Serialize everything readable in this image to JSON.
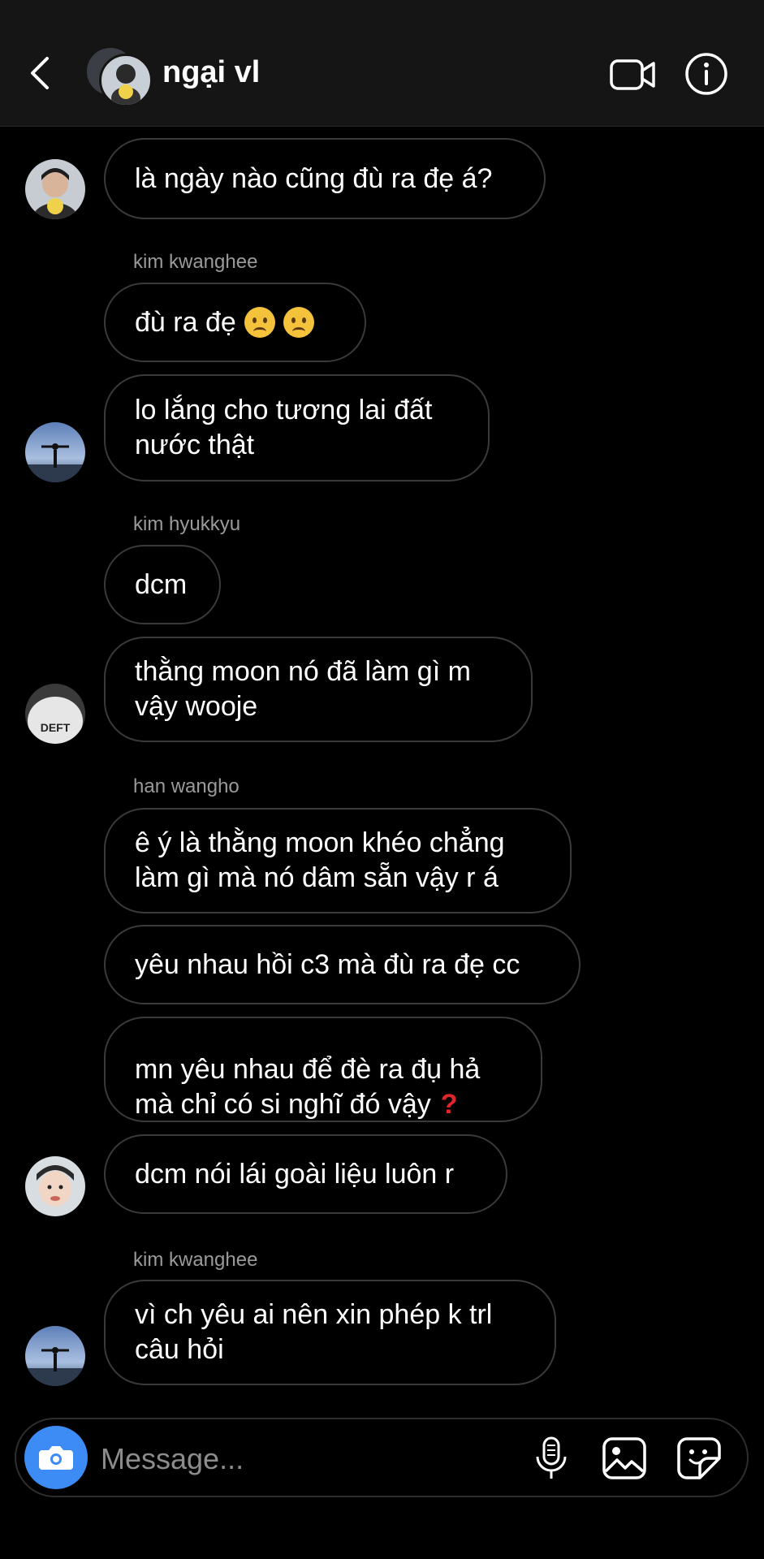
{
  "header": {
    "title": "ngại vl",
    "icons": {
      "back": "chevron-left-icon",
      "video": "video-camera-icon",
      "info": "info-icon"
    }
  },
  "messages": [
    {
      "sender": "",
      "text": "là ngày nào cũng đù ra đẹ á?"
    },
    {
      "sender": "kim kwanghee",
      "text": "đù ra đẹ"
    },
    {
      "sender": "",
      "text": "lo lắng cho tương lai đất\nnước thật"
    },
    {
      "sender": "kim hyukkyu",
      "text": "dcm"
    },
    {
      "sender": "",
      "text": "thằng moon nó đã làm gì m\nvậy wooje"
    },
    {
      "sender": "han wangho",
      "text": "ê ý là thằng moon khéo chẳng\nlàm gì mà nó dâm sẵn vậy r á"
    },
    {
      "sender": "",
      "text": "yêu nhau hồi c3 mà đù ra đẹ cc"
    },
    {
      "sender": "",
      "text": "mn yêu nhau để đè ra đụ hả\nmà chỉ có si nghĩ đó vậy"
    },
    {
      "sender": "",
      "text": "dcm nói lái goài liệu luôn r"
    },
    {
      "sender": "kim kwanghee",
      "text": "vì ch yêu ai nên xin phép k trl\ncâu hỏi"
    }
  ],
  "avatars": {
    "a1": "avatar-person-figurine",
    "a2": "avatar-person-arms-out",
    "a3": "avatar-deft-jacket",
    "a4": "avatar-person-face",
    "a5": "avatar-person-arms-out"
  },
  "composer": {
    "placeholder": "Message...",
    "icons": {
      "camera": "camera-icon",
      "mic": "microphone-icon",
      "gallery": "gallery-icon",
      "sticker": "sticker-icon"
    }
  },
  "colors": {
    "background": "#000000",
    "header": "#151515",
    "bubble_border": "#3a3a3a",
    "camera_button": "#3d8cf5"
  }
}
